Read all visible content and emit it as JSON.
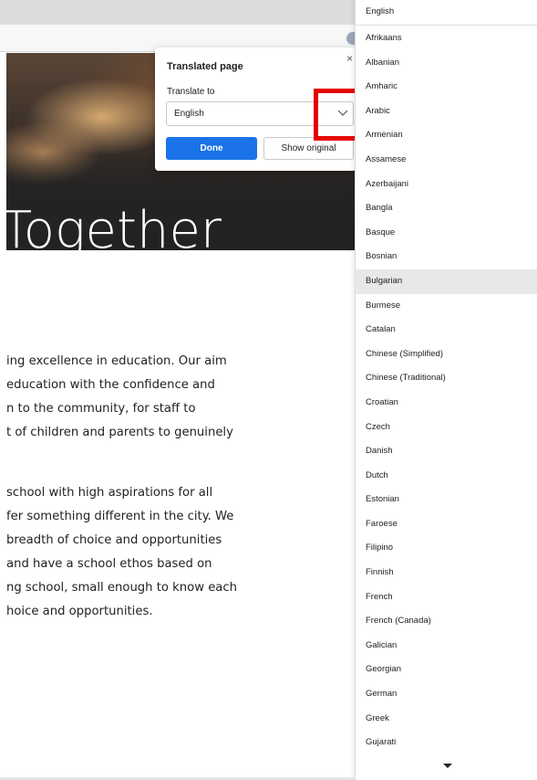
{
  "hero": {
    "title": "Together"
  },
  "body_text": {
    "para1": [
      "ing excellence in education. Our aim",
      "education with the confidence and",
      "n to the community, for staff to",
      "t of children and parents to genuinely"
    ],
    "para2": [
      "school with high aspirations for all",
      "fer something different in the city. We",
      " breadth of choice and opportunities",
      "and have a school ethos based on",
      "ng school, small enough to know each",
      "hoice and opportunities."
    ]
  },
  "translate_popup": {
    "title": "Translated page",
    "translate_to_label": "Translate to",
    "selected_language": "English",
    "done_label": "Done",
    "show_original_label": "Show original",
    "close_icon": "×",
    "chevron_icon": "chevron-down-icon",
    "primary_color": "#1a73e8",
    "highlight_color": "#e60000"
  },
  "language_dropdown": {
    "current": "English",
    "hovered": "Bulgarian",
    "options": [
      "Afrikaans",
      "Albanian",
      "Amharic",
      "Arabic",
      "Armenian",
      "Assamese",
      "Azerbaijani",
      "Bangla",
      "Basque",
      "Bosnian",
      "Bulgarian",
      "Burmese",
      "Catalan",
      "Chinese (Simplified)",
      "Chinese (Traditional)",
      "Croatian",
      "Czech",
      "Danish",
      "Dutch",
      "Estonian",
      "Faroese",
      "Filipino",
      "Finnish",
      "French",
      "French (Canada)",
      "Galician",
      "Georgian",
      "German",
      "Greek",
      "Gujarati"
    ],
    "scroll_icon": "caret-down-icon"
  }
}
